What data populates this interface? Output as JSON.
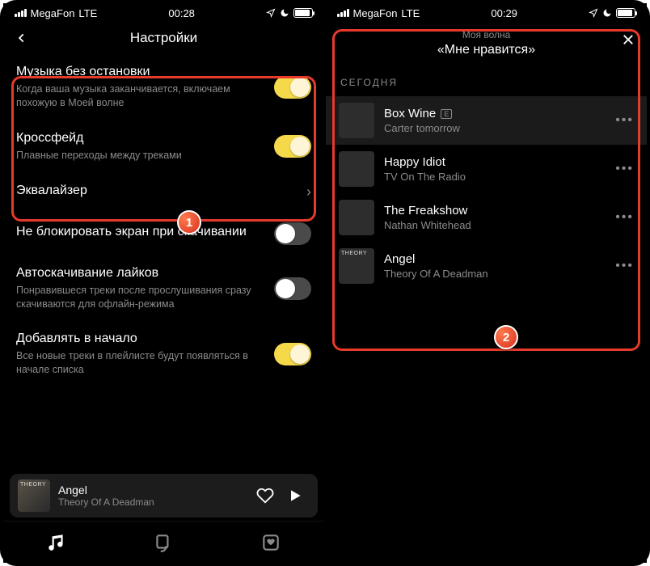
{
  "left": {
    "status": {
      "carrier": "MegaFon",
      "net": "LTE",
      "time": "00:28"
    },
    "header": {
      "title": "Настройки"
    },
    "settings": [
      {
        "key": "nonstop",
        "title": "Музыка без остановки",
        "sub": "Когда ваша музыка заканчивается, включаем похожую в Моей волне",
        "on": true,
        "type": "toggle"
      },
      {
        "key": "crossfade",
        "title": "Кроссфейд",
        "sub": "Плавные переходы между треками",
        "on": true,
        "type": "toggle"
      },
      {
        "key": "eq",
        "title": "Эквалайзер",
        "sub": "",
        "type": "link"
      },
      {
        "key": "nolock",
        "title": "Не блокировать экран при скачивании",
        "sub": "",
        "on": false,
        "type": "toggle"
      },
      {
        "key": "autodl",
        "title": "Автоскачивание лайков",
        "sub": "Понравившеся треки после прослушивания сразу скачиваются для офлайн-режима",
        "on": false,
        "type": "toggle"
      },
      {
        "key": "addtop",
        "title": "Добавлять в начало",
        "sub": "Все новые треки в плейлисте будут появляться в начале списка",
        "on": true,
        "type": "toggle"
      }
    ],
    "miniplayer": {
      "title": "Angel",
      "artist": "Theory Of A Deadman"
    },
    "badge": "1"
  },
  "right": {
    "status": {
      "carrier": "MegaFon",
      "net": "LTE",
      "time": "00:29"
    },
    "queue": {
      "context": "Моя волна",
      "title": "«Мне нравится»",
      "section": "СЕГОДНЯ",
      "tracks": [
        {
          "name": "Box Wine",
          "artist": "Carter tomorrow",
          "explicit": true,
          "active": true
        },
        {
          "name": "Happy Idiot",
          "artist": "TV On The Radio",
          "explicit": false,
          "active": false
        },
        {
          "name": "The Freakshow",
          "artist": "Nathan Whitehead",
          "explicit": false,
          "active": false
        },
        {
          "name": "Angel",
          "artist": "Theory Of A Deadman",
          "explicit": false,
          "active": false
        }
      ]
    },
    "badge": "2"
  }
}
